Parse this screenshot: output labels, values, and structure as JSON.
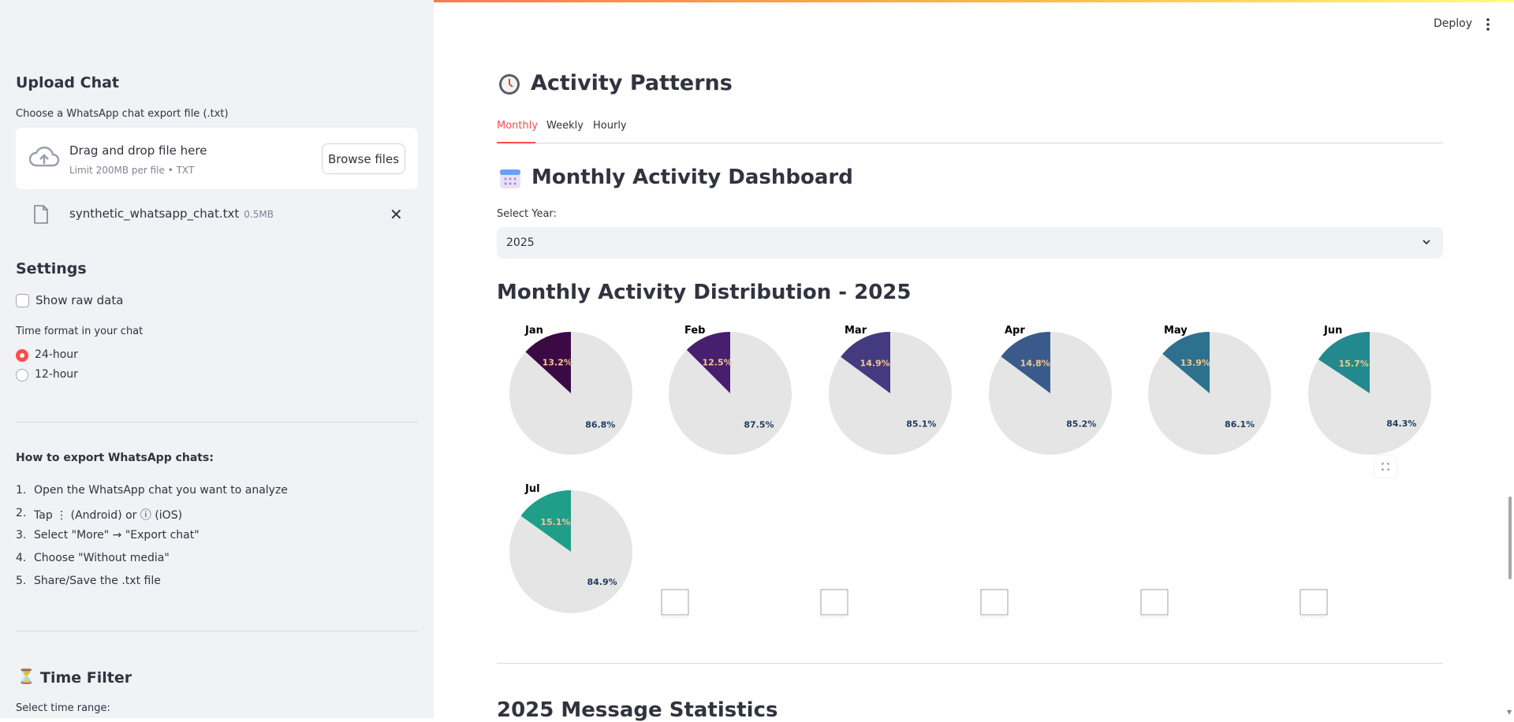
{
  "sidebar": {
    "upload_title": "Upload Chat",
    "upload_label": "Choose a WhatsApp chat export file (.txt)",
    "dropzone_title": "Drag and drop file here",
    "dropzone_sub": "Limit 200MB per file • TXT",
    "browse_label": "Browse files",
    "file_name": "synthetic_whatsapp_chat.txt",
    "file_size": "0.5MB",
    "settings_title": "Settings",
    "show_raw_label": "Show raw data",
    "time_format_label": "Time format in your chat",
    "radio_24": "24-hour",
    "radio_12": "12-hour",
    "how_to_title": "How to export WhatsApp chats:",
    "steps": [
      "Open the WhatsApp chat you want to analyze",
      "Tap ⋮ (Android) or ⓘ (iOS)",
      "Select \"More\" → \"Export chat\"",
      "Choose \"Without media\"",
      "Share/Save the .txt file"
    ],
    "step_nums": [
      "1.",
      "2.",
      "3.",
      "4.",
      "5."
    ],
    "time_filter_title": "Time Filter",
    "time_range_label": "Select time range:"
  },
  "header": {
    "deploy_label": "Deploy"
  },
  "main": {
    "activity_title": "Activity Patterns",
    "tabs": [
      "Monthly",
      "Weekly",
      "Hourly"
    ],
    "active_tab": "Monthly",
    "dashboard_title": "Monthly Activity Dashboard",
    "select_year_label": "Select Year:",
    "select_year_value": "2025",
    "distribution_title": "Monthly Activity Distribution - 2025",
    "stats_title": "2025 Message Statistics"
  },
  "chart_data": {
    "type": "pie",
    "title": "Monthly Activity Distribution - 2025",
    "charts": [
      {
        "month": "Jan",
        "share_label": "13.2%",
        "rest_label": "86.8%",
        "share": 13.2,
        "color": "#3b0a45"
      },
      {
        "month": "Feb",
        "share_label": "12.5%",
        "rest_label": "87.5%",
        "share": 12.5,
        "color": "#471f6e"
      },
      {
        "month": "Mar",
        "share_label": "14.9%",
        "rest_label": "85.1%",
        "share": 14.9,
        "color": "#433a80"
      },
      {
        "month": "Apr",
        "share_label": "14.8%",
        "rest_label": "85.2%",
        "share": 14.8,
        "color": "#3a5a8c"
      },
      {
        "month": "May",
        "share_label": "13.9%",
        "rest_label": "86.1%",
        "share": 13.9,
        "color": "#2d718e"
      },
      {
        "month": "Jun",
        "share_label": "15.7%",
        "rest_label": "84.3%",
        "share": 15.7,
        "color": "#23898e"
      },
      {
        "month": "Jul",
        "share_label": "15.1%",
        "rest_label": "84.9%",
        "share": 15.1,
        "color": "#1f9e89"
      }
    ],
    "rest_color": "#e5e5e5",
    "share_label_color": "#f6c68b",
    "rest_label_color": "#1f3a5f"
  }
}
